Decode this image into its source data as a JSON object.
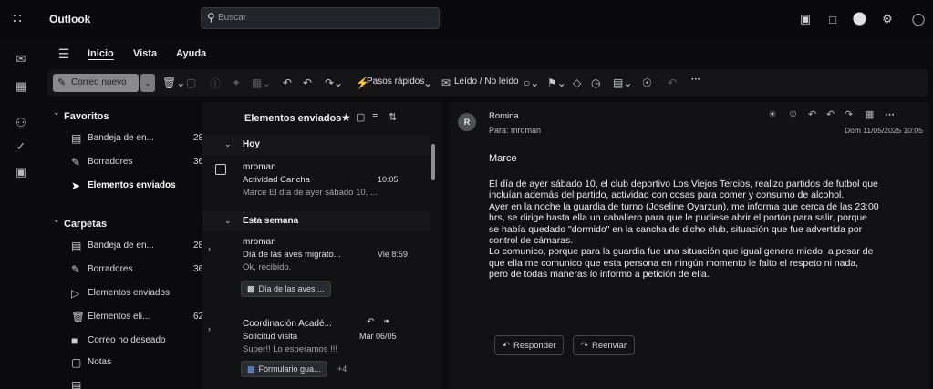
{
  "app": {
    "title": "Outlook"
  },
  "search": {
    "placeholder": "Buscar"
  },
  "nav": {
    "tabs": [
      "Inicio",
      "Vista",
      "Ayuda"
    ]
  },
  "ribbon": {
    "new_mail": "Correo nuevo",
    "quick_steps": "Pasos rápidos",
    "read_unread": "Leído / No leído",
    "more": "···"
  },
  "folders": {
    "favorites_title": "Favoritos",
    "favorites": [
      {
        "label": "Bandeja de en...",
        "count": "28",
        "icon": "inbox-icon"
      },
      {
        "label": "Borradores",
        "count": "36",
        "icon": "drafts-icon"
      },
      {
        "label": "Elementos enviados",
        "count": "",
        "icon": "sent-icon",
        "active": true
      }
    ],
    "folders_title": "Carpetas",
    "items": [
      {
        "label": "Bandeja de en...",
        "count": "28",
        "icon": "inbox-icon"
      },
      {
        "label": "Borradores",
        "count": "36",
        "icon": "drafts-icon"
      },
      {
        "label": "Elementos enviados",
        "count": "",
        "icon": "sent-icon"
      },
      {
        "label": "Elementos eli...",
        "count": "62",
        "icon": "trash-icon"
      },
      {
        "label": "Correo no deseado",
        "count": "",
        "icon": "junk-icon"
      },
      {
        "label": "Notas",
        "count": "",
        "icon": "notes-icon"
      }
    ]
  },
  "list": {
    "title": "Elementos enviados",
    "groups": [
      "Hoy",
      "Esta semana"
    ],
    "messages": [
      {
        "sender": "mroman",
        "subject": "Actividad Cancha",
        "time": "10:05",
        "preview": "Marce El día de ayer sábado 10, ..."
      },
      {
        "sender": "mroman",
        "subject": "Día de las aves migrato...",
        "time": "Vie 8:59",
        "preview": "Ok, recibido.",
        "attachment": "Día de las aves ..."
      },
      {
        "sender": "Coordinación Acadé...",
        "subject": "Solicitud visita",
        "time": "Mar 06/05",
        "preview": "Super!! Lo esperamos !!!",
        "attachment": "Formulario gua...",
        "extra": "+4"
      }
    ]
  },
  "reading": {
    "avatar": "R",
    "from": "Romina",
    "to": "Para: mroman",
    "date": "Dom 11/05/2025 10:05",
    "subject": "Marce",
    "body": [
      "El día de ayer sábado 10, el club deportivo Los Viejos Tercios, realizo partidos de futbol que",
      "incluían además del partido, actividad con cosas para comer y consumo de alcohol.",
      "Ayer en la noche la guardia de turno (Joseline Oyarzun), me informa que cerca de las 23:00",
      "hrs, se dirige hasta ella un caballero para que le pudiese abrir el portón para salir, porque",
      "se había quedado \"dormido\" en la cancha de dicho club, situación que fue advertida por",
      "control de cámaras.",
      "Lo comunico, porque para la guardia fue una situación que igual genera miedo, a pesar de",
      "que ella me comunico que esta persona en ningún momento le falto el respeto ni nada,",
      "pero de todas maneras lo informo a petición de ella."
    ],
    "reply": "Responder",
    "forward": "Reenviar"
  }
}
